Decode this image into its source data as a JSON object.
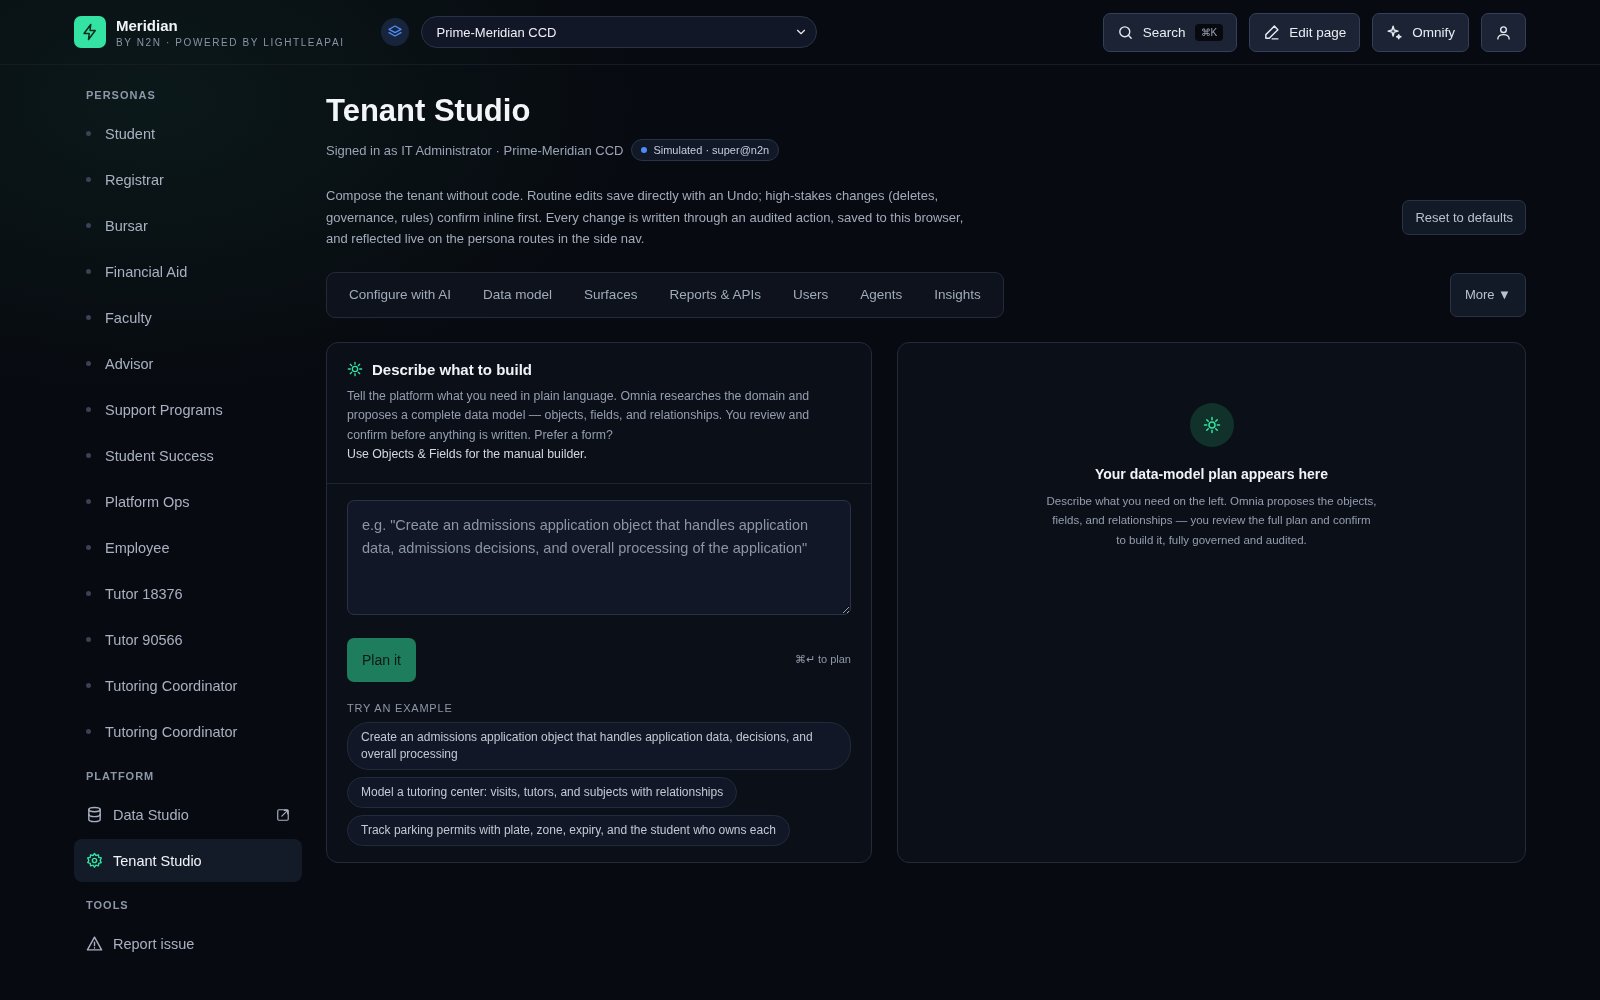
{
  "brand": {
    "name": "Meridian",
    "tagline": "BY N2N · POWERED BY LIGHTLEAPAI"
  },
  "tenant_select": {
    "value": "Prime-Meridian CCD"
  },
  "header_actions": [
    {
      "kind": "search",
      "label": "Search",
      "shortcut": "⌘K"
    },
    {
      "kind": "edit",
      "label": "Edit page"
    },
    {
      "kind": "omnify",
      "label": "Omnify"
    },
    {
      "kind": "account"
    }
  ],
  "sidebar": {
    "sections": [
      {
        "title": "PERSONAS",
        "items": [
          {
            "kind": "persona",
            "label": "Student",
            "selected": false
          },
          {
            "kind": "persona",
            "label": "Registrar",
            "selected": false
          },
          {
            "kind": "persona",
            "label": "Bursar",
            "selected": false
          },
          {
            "kind": "persona",
            "label": "Financial Aid",
            "selected": false
          },
          {
            "kind": "persona",
            "label": "Faculty",
            "selected": false
          },
          {
            "kind": "persona",
            "label": "Advisor",
            "selected": false
          },
          {
            "kind": "persona",
            "label": "Support Programs",
            "selected": false
          },
          {
            "kind": "persona",
            "label": "Student Success",
            "selected": false
          },
          {
            "kind": "persona",
            "label": "Platform Ops",
            "selected": false
          },
          {
            "kind": "persona",
            "label": "Employee",
            "selected": false
          },
          {
            "kind": "persona",
            "label": "Tutor 18376",
            "selected": false
          },
          {
            "kind": "persona",
            "label": "Tutor 90566",
            "selected": false
          },
          {
            "kind": "persona",
            "label": "Tutoring Coordinator",
            "selected": false
          },
          {
            "kind": "persona",
            "label": "Tutoring Coordinator",
            "selected": false
          }
        ]
      },
      {
        "title": "PLATFORM",
        "items": [
          {
            "kind": "database",
            "label": "Data Studio",
            "external": true,
            "selected": false
          },
          {
            "kind": "settings",
            "label": "Tenant Studio",
            "selected": true
          }
        ]
      },
      {
        "title": "TOOLS",
        "items": [
          {
            "kind": "warning",
            "label": "Report issue",
            "selected": false
          }
        ]
      }
    ]
  },
  "page": {
    "title": "Tenant Studio",
    "signed_in": "Signed in as IT Administrator · Prime-Meridian CCD",
    "badge": "Simulated · super@n2n",
    "intro": "Compose the tenant without code. Routine edits save directly with an Undo; high-stakes changes (deletes, governance, rules) confirm inline first. Every change is written through an audited action, saved to this browser, and reflected live on the persona routes in the side nav.",
    "reset_button": "Reset to defaults"
  },
  "tabs": [
    {
      "label": "Configure with AI",
      "selected": false
    },
    {
      "label": "Data model",
      "selected": false
    },
    {
      "label": "Surfaces",
      "selected": false
    },
    {
      "label": "Reports & APIs",
      "selected": false
    },
    {
      "label": "Users",
      "selected": false
    },
    {
      "label": "Agents",
      "selected": false
    },
    {
      "label": "Insights",
      "selected": false
    }
  ],
  "more_button": {
    "label": "More",
    "caret": "▼"
  },
  "builder": {
    "title": "Describe what to build",
    "description": "Tell the platform what you need in plain language. Omnia researches the domain and proposes a complete data model — objects, fields, and relationships. You review and confirm before anything is written. Prefer a form?",
    "link": "Use Objects & Fields for the manual builder.",
    "prompt": {
      "placeholder": "e.g. \"Create an admissions application object that handles application data, admissions decisions, and overall processing of the application\""
    },
    "plan_button": "Plan it",
    "shortcut_hint": "⌘↵ to plan",
    "examples_title": "TRY AN EXAMPLE",
    "examples": [
      "Create an admissions application object that handles application data, decisions, and overall processing",
      "Model a tutoring center: visits, tutors, and subjects with relationships",
      "Track parking permits with plate, zone, expiry, and the student who owns each"
    ]
  },
  "plan_panel": {
    "title": "Your data-model plan appears here",
    "text": "Describe what you need on the left. Omnia proposes the objects, fields, and relationships — you review the full plan and confirm to build it, fully governed and audited."
  }
}
